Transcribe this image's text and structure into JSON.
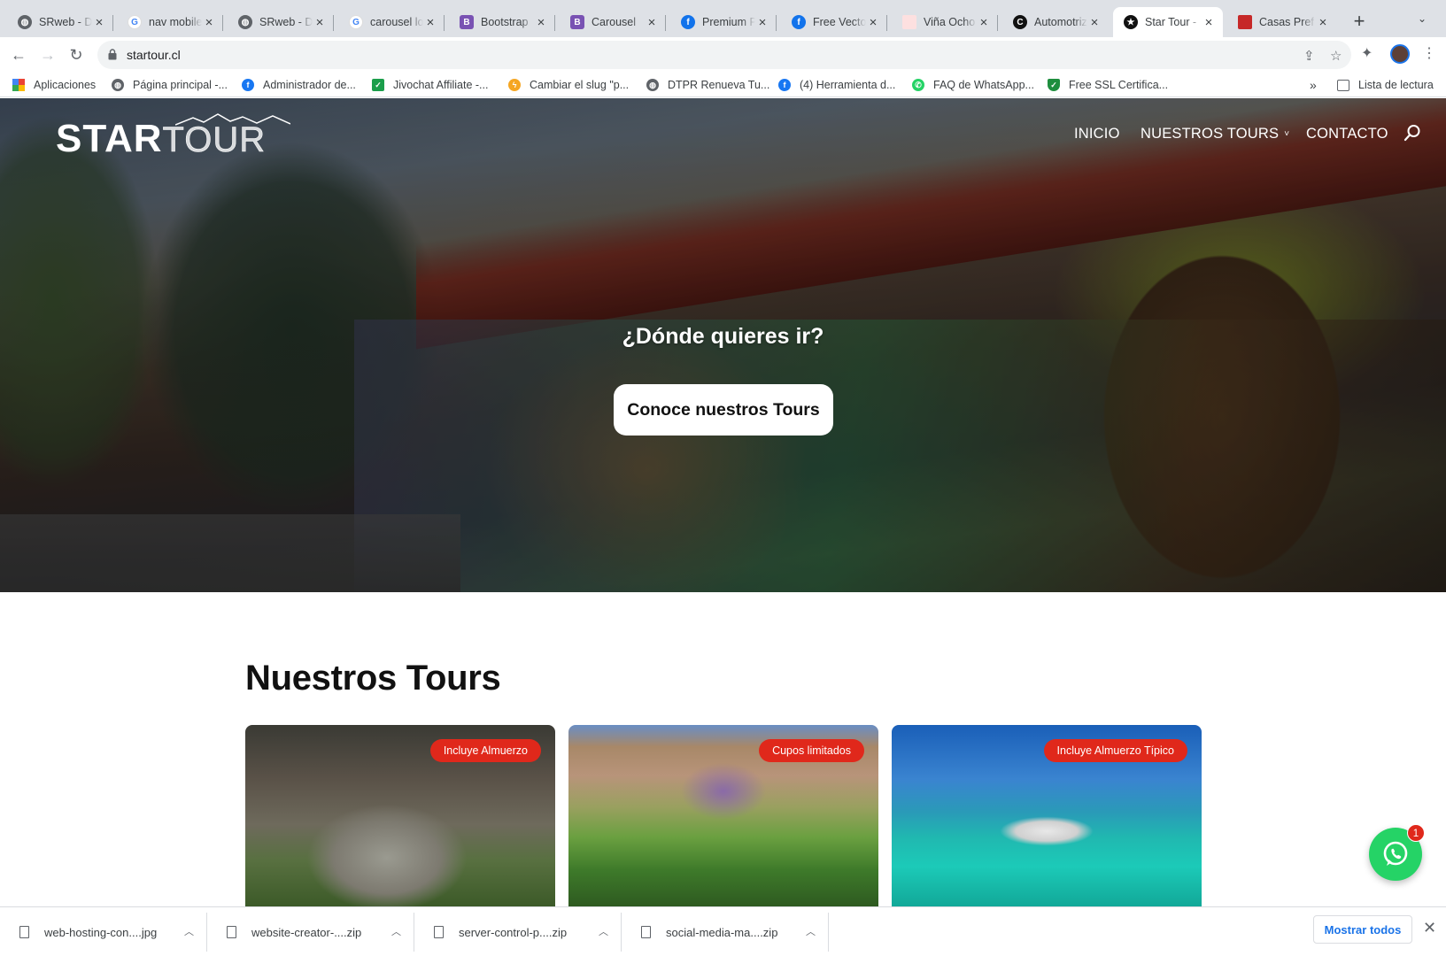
{
  "tabs": [
    {
      "title": "SRweb - D",
      "icon": "globe-icon",
      "color": "#5f6368"
    },
    {
      "title": "nav mobile",
      "icon": "google-icon",
      "color": "#4285f4"
    },
    {
      "title": "SRweb - D",
      "icon": "globe-icon",
      "color": "#5f6368"
    },
    {
      "title": "carousel lo",
      "icon": "google-icon",
      "color": "#4285f4"
    },
    {
      "title": "Bootstrap",
      "icon": "bootstrap-icon",
      "color": "#7952b3"
    },
    {
      "title": "Carousel",
      "icon": "bootstrap-icon",
      "color": "#7952b3"
    },
    {
      "title": "Premium P",
      "icon": "freepik-icon",
      "color": "#1273eb"
    },
    {
      "title": "Free Vecto",
      "icon": "freepik-icon",
      "color": "#1273eb"
    },
    {
      "title": "Viña Ocho",
      "icon": "site-icon",
      "color": "#e57373"
    },
    {
      "title": "Automotriz",
      "icon": "c-icon",
      "color": "#111111"
    },
    {
      "title": "Star Tour -",
      "icon": "startour-icon",
      "color": "#111111",
      "active": true
    },
    {
      "title": "Casas Pref",
      "icon": "site-icon",
      "color": "#c62828"
    }
  ],
  "address_bar": {
    "url": "startour.cl"
  },
  "bookmarks": [
    {
      "label": "Aplicaciones",
      "icon": "apps-grid-icon"
    },
    {
      "label": "Página principal -...",
      "icon": "globe-icon"
    },
    {
      "label": "Administrador de...",
      "icon": "facebook-icon"
    },
    {
      "label": "Jivochat Affiliate -...",
      "icon": "jivochat-icon"
    },
    {
      "label": "Cambiar el slug \"p...",
      "icon": "bolt-icon"
    },
    {
      "label": "DTPR Renueva Tu...",
      "icon": "globe-icon"
    },
    {
      "label": "(4) Herramienta d...",
      "icon": "facebook-icon"
    },
    {
      "label": "FAQ de WhatsApp...",
      "icon": "whatsapp-icon"
    },
    {
      "label": "Free SSL Certifica...",
      "icon": "shield-icon"
    }
  ],
  "bookmarks_overflow": "»",
  "reading_list": "Lista de lectura",
  "site": {
    "logo_bold": "STAR",
    "logo_light": "TOUR",
    "nav": [
      "INICIO",
      "NUESTROS TOURS",
      "CONTACTO"
    ],
    "hero_question": "¿Dónde quieres ir?",
    "hero_cta": "Conoce nuestros Tours",
    "section_title": "Nuestros Tours",
    "cards": [
      {
        "badge": "Incluye Almuerzo"
      },
      {
        "badge": "Cupos limitados"
      },
      {
        "badge": "Incluye Almuerzo Típico"
      }
    ],
    "whatsapp_count": "1"
  },
  "downloads": [
    {
      "name": "web-hosting-con....jpg"
    },
    {
      "name": "website-creator-....zip"
    },
    {
      "name": "server-control-p....zip"
    },
    {
      "name": "social-media-ma....zip"
    }
  ],
  "downloads_show_all": "Mostrar todos",
  "colors": {
    "accent_red": "#e0281b",
    "whatsapp_green": "#25d366",
    "chrome_blue": "#1a73e8"
  }
}
